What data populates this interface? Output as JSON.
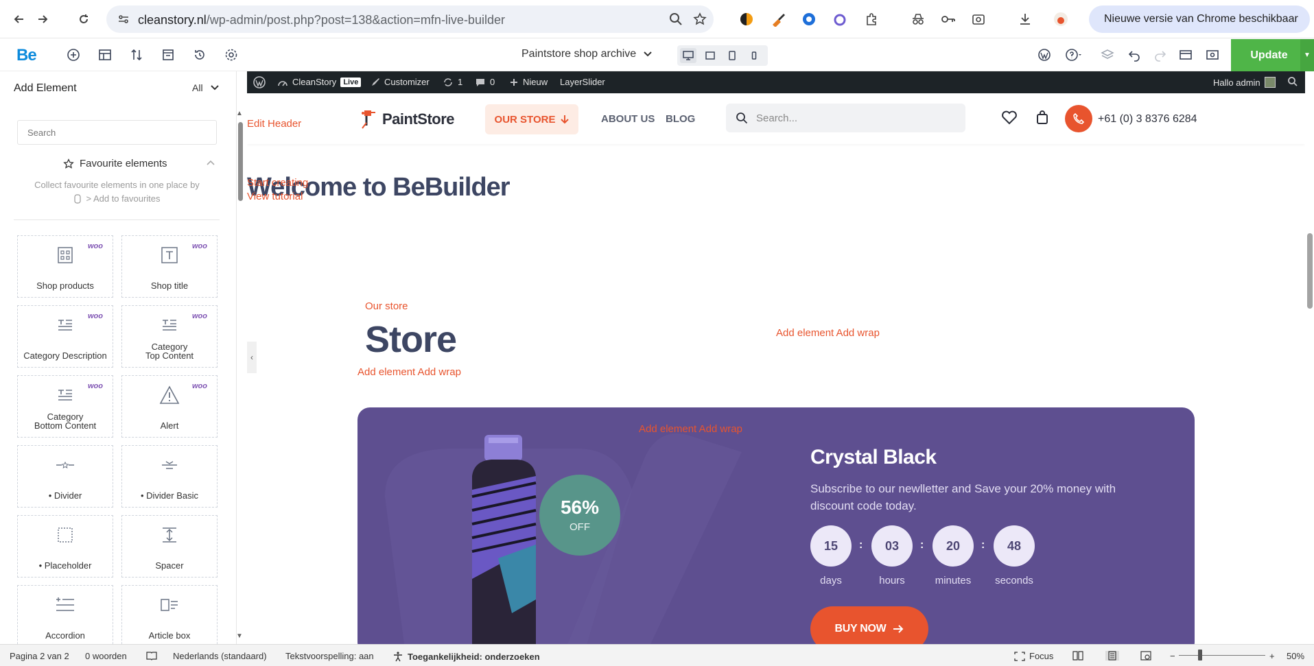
{
  "chrome": {
    "url_host": "cleanstory.nl",
    "url_path": "/wp-admin/post.php?post=138&action=mfn-live-builder",
    "update_chip": "Nieuwe versie van Chrome beschikbaar"
  },
  "builder": {
    "logo": "Be",
    "page_name": "Paintstore shop archive",
    "update_label": "Update"
  },
  "panel": {
    "title": "Add Element",
    "filter": "All",
    "search_placeholder": "Search",
    "favourites_title": "Favourite elements",
    "favourites_hint": "Collect favourite elements in one place by",
    "favourites_hint_link": "> Add to favourites",
    "woo_badge": "woo",
    "elements": [
      {
        "label": "Shop products",
        "icon": "shop-products-icon",
        "woo": true
      },
      {
        "label": "Shop title",
        "icon": "shop-title-icon",
        "woo": true
      },
      {
        "label": "Category Description",
        "icon": "category-description-icon",
        "woo": true
      },
      {
        "label": "Category\nTop Content",
        "icon": "category-top-content-icon",
        "woo": true
      },
      {
        "label": "Category\nBottom Content",
        "icon": "category-bottom-content-icon",
        "woo": true
      },
      {
        "label": "Alert",
        "icon": "alert-icon",
        "woo": true
      },
      {
        "label": "• Divider",
        "icon": "divider-icon",
        "woo": false
      },
      {
        "label": "• Divider Basic",
        "icon": "divider-basic-icon",
        "woo": false
      },
      {
        "label": "• Placeholder",
        "icon": "placeholder-icon",
        "woo": false
      },
      {
        "label": "Spacer",
        "icon": "spacer-icon",
        "woo": false
      },
      {
        "label": "Accordion",
        "icon": "accordion-icon",
        "woo": false
      },
      {
        "label": "Article box",
        "icon": "article-box-icon",
        "woo": false
      }
    ]
  },
  "adminbar": {
    "site": "CleanStory",
    "live": "Live",
    "customizer": "Customizer",
    "updates": "1",
    "comments": "0",
    "new": "Nieuw",
    "layerslider": "LayerSlider",
    "greeting": "Hallo admin"
  },
  "site": {
    "logo": "PaintStore",
    "nav_store": "OUR STORE",
    "nav_about": "ABOUT US",
    "nav_blog": "BLOG",
    "search_placeholder": "Search...",
    "phone": "+61 (0) 3 8376 6284"
  },
  "content": {
    "edit_header": "Edit Header",
    "welcome": "Welcome to BeBuilder",
    "start_creating": "Start creating",
    "view_tutorial": "View tutorial",
    "store_label": "Our store",
    "store_title": "Store",
    "add_element_wrap": "Add element Add wrap"
  },
  "promo": {
    "discount": "56%",
    "discount_off": "OFF",
    "title": "Crystal Black",
    "subtitle": "Subscribe to our newlletter and Save your 20% money with discount code today.",
    "countdown": [
      {
        "value": "15",
        "unit": "days"
      },
      {
        "value": "03",
        "unit": "hours"
      },
      {
        "value": "20",
        "unit": "minutes"
      },
      {
        "value": "48",
        "unit": "seconds"
      }
    ],
    "button": "BUY NOW",
    "colors": {
      "bg": "#5e4f90",
      "accent": "#e8542e",
      "circle": "#58958a"
    }
  },
  "statusbar": {
    "page": "Pagina 2 van 2",
    "words": "0 woorden",
    "language": "Nederlands (standaard)",
    "spellcheck": "Tekstvoorspelling: aan",
    "accessibility": "Toegankelijkheid: onderzoeken",
    "focus": "Focus",
    "zoom": "50%"
  }
}
